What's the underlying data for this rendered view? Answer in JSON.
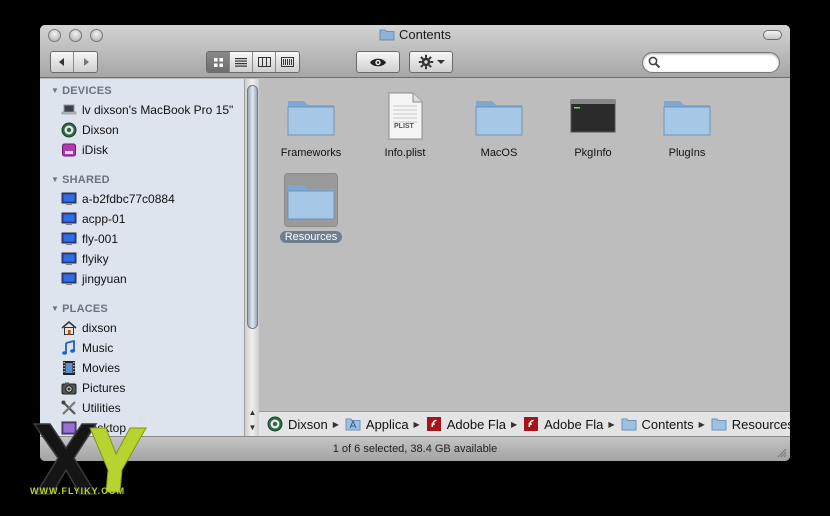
{
  "window": {
    "title": "Contents",
    "status": "1 of 6 selected, 38.4 GB available",
    "search_placeholder": ""
  },
  "sidebar": {
    "sections": [
      {
        "header": "DEVICES",
        "items": [
          {
            "label": "lv dixson's MacBook Pro 15\"",
            "icon": "laptop-icon"
          },
          {
            "label": "Dixson",
            "icon": "disk-icon"
          },
          {
            "label": "iDisk",
            "icon": "idisk-icon"
          }
        ]
      },
      {
        "header": "SHARED",
        "items": [
          {
            "label": "a-b2fdbc77c0884",
            "icon": "network-computer-icon"
          },
          {
            "label": "acpp-01",
            "icon": "network-computer-icon"
          },
          {
            "label": "fly-001",
            "icon": "network-computer-icon"
          },
          {
            "label": "flyiky",
            "icon": "network-computer-icon"
          },
          {
            "label": "jingyuan",
            "icon": "network-computer-icon"
          }
        ]
      },
      {
        "header": "PLACES",
        "items": [
          {
            "label": "dixson",
            "icon": "home-icon"
          },
          {
            "label": "Music",
            "icon": "music-icon"
          },
          {
            "label": "Movies",
            "icon": "movies-icon"
          },
          {
            "label": "Pictures",
            "icon": "pictures-icon"
          },
          {
            "label": "Utilities",
            "icon": "utilities-icon"
          },
          {
            "label": "Desktop",
            "icon": "desktop-icon"
          }
        ]
      }
    ]
  },
  "files": [
    {
      "name": "Frameworks",
      "icon": "folder-icon",
      "selected": false
    },
    {
      "name": "Info.plist",
      "icon": "plist-file-icon",
      "selected": false
    },
    {
      "name": "MacOS",
      "icon": "folder-icon",
      "selected": false
    },
    {
      "name": "PkgInfo",
      "icon": "terminal-file-icon",
      "selected": false
    },
    {
      "name": "PlugIns",
      "icon": "folder-icon",
      "selected": false
    },
    {
      "name": "Resources",
      "icon": "folder-icon",
      "selected": true
    }
  ],
  "path": [
    {
      "label": "Dixson",
      "icon": "disk-icon"
    },
    {
      "label": "Applica",
      "icon": "applications-icon"
    },
    {
      "label": "Adobe Fla",
      "icon": "flash-icon"
    },
    {
      "label": "Adobe Fla",
      "icon": "flash-icon"
    },
    {
      "label": "Contents",
      "icon": "folder-icon"
    },
    {
      "label": "Resources",
      "icon": "folder-icon"
    }
  ],
  "plist_badge": "PLIST",
  "watermark": {
    "url": "WWW.FLYIKY.COM",
    "registered": "®"
  },
  "colors": {
    "sidebar_bg": "#dde4ee",
    "content_bg": "#bdbdbd",
    "folder_blue": "#8fb3d6",
    "selection": "#6f7d8f",
    "watermark_green": "#b7d330"
  }
}
